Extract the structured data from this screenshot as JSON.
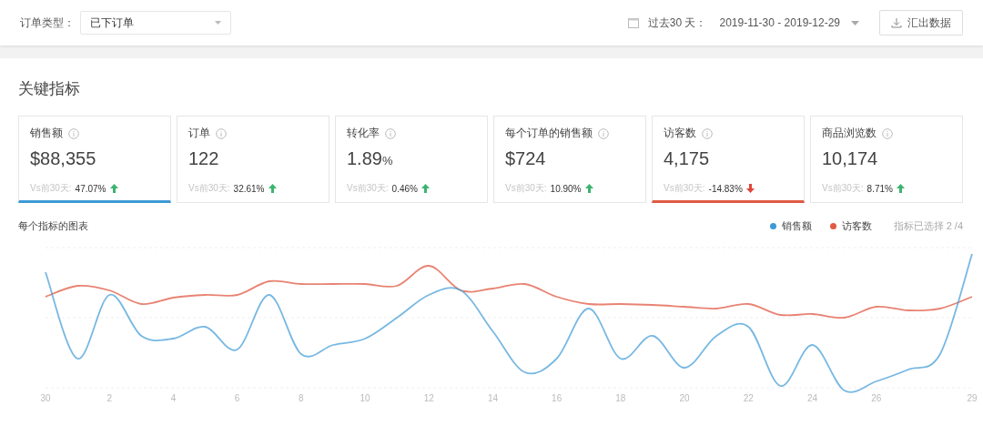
{
  "filter_bar": {
    "order_type_label": "订单类型：",
    "order_type_value": "已下订单",
    "period_label": "过去30 天：",
    "date_range": "2019-11-30 - 2019-12-29",
    "export_button": "汇出数据"
  },
  "section_title": "关键指标",
  "metrics": [
    {
      "label": "销售额",
      "value": "$88,355",
      "compare_label": "Vs前30天:",
      "change": "47.07%",
      "rising": true,
      "selected": true,
      "color": "#3d9ad6"
    },
    {
      "label": "订单",
      "value": "122",
      "compare_label": "Vs前30天:",
      "change": "32.61%",
      "rising": true,
      "selected": false
    },
    {
      "label": "转化率",
      "value": "1.89",
      "unit": "%",
      "compare_label": "Vs前30天:",
      "change": "0.46%",
      "rising": true,
      "selected": false
    },
    {
      "label": "每个订单的销售额",
      "value": "$724",
      "compare_label": "Vs前30天:",
      "change": "10.90%",
      "rising": true,
      "selected": false
    },
    {
      "label": "访客数",
      "value": "4,175",
      "compare_label": "Vs前30天:",
      "change": "-14.83%",
      "rising": false,
      "selected": true,
      "color": "#e05a44"
    },
    {
      "label": "商品浏览数",
      "value": "10,174",
      "compare_label": "Vs前30天:",
      "change": "8.71%",
      "rising": true,
      "selected": false
    }
  ],
  "chart": {
    "title": "每个指标的图表",
    "legend": [
      {
        "label": "销售额",
        "color": "#3d9ad6"
      },
      {
        "label": "访客数",
        "color": "#e05a44"
      }
    ],
    "selection_count": "指标已选择 2 /4",
    "x_labels": [
      "30",
      "2",
      "4",
      "6",
      "8",
      "10",
      "12",
      "14",
      "16",
      "18",
      "20",
      "22",
      "24",
      "26",
      "29"
    ]
  }
}
